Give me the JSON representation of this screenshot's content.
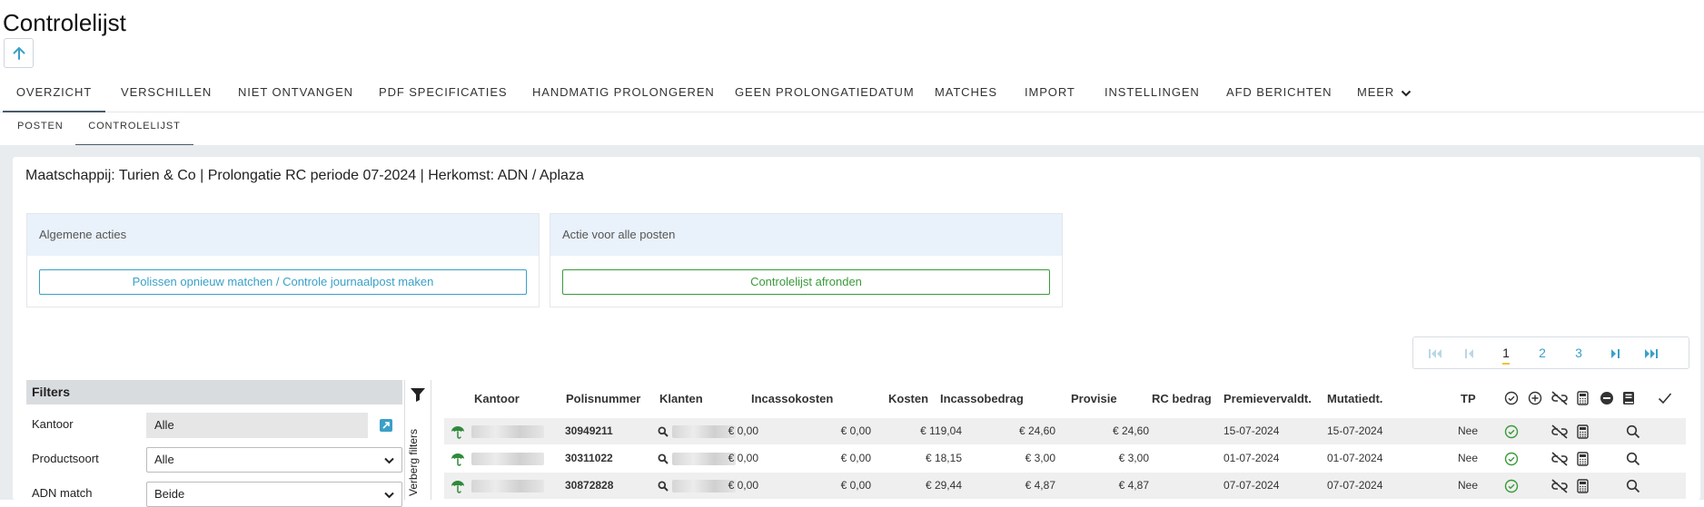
{
  "page": {
    "title": "Controlelijst"
  },
  "tabs": [
    {
      "label": "OVERZICHT",
      "active": true
    },
    {
      "label": "VERSCHILLEN"
    },
    {
      "label": "NIET ONTVANGEN"
    },
    {
      "label": "PDF SPECIFICATIES"
    },
    {
      "label": "HANDMATIG PROLONGEREN"
    },
    {
      "label": "GEEN PROLONGATIEDATUM"
    },
    {
      "label": "MATCHES"
    },
    {
      "label": "IMPORT"
    },
    {
      "label": "INSTELLINGEN"
    },
    {
      "label": "AFD BERICHTEN"
    },
    {
      "label": "MEER"
    }
  ],
  "subtabs": [
    {
      "label": "POSTEN"
    },
    {
      "label": "CONTROLELIJST",
      "active": true
    }
  ],
  "context": "Maatschappij: Turien & Co | Prolongatie RC periode 07-2024 | Herkomst: ADN / Aplaza",
  "cards": {
    "general": {
      "title": "Algemene acties",
      "button": "Polissen opnieuw matchen / Controle journaalpost maken",
      "color": "#3aa0c8"
    },
    "all": {
      "title": "Actie voor alle posten",
      "button": "Controlelijst afronden",
      "color": "#3a9a3a"
    }
  },
  "pagination": {
    "pages": [
      "1",
      "2",
      "3"
    ],
    "current": "1"
  },
  "filters": {
    "title": "Filters",
    "items": [
      {
        "label": "Kantoor",
        "value": "Alle"
      },
      {
        "label": "Productsoort",
        "value": "Alle"
      },
      {
        "label": "ADN match",
        "value": "Beide"
      }
    ],
    "toggle_label": "Verberg filters"
  },
  "table": {
    "headers": {
      "kantoor": "Kantoor",
      "polisnummer": "Polisnummer",
      "klanten": "Klanten",
      "incassokosten": "Incassokosten",
      "kosten": "Kosten",
      "incassobedrag": "Incassobedrag",
      "provisie": "Provisie",
      "rc_bedrag": "RC bedrag",
      "premievervaldt": "Premievervaldt.",
      "mutatiedt": "Mutatiedt.",
      "tp": "TP"
    },
    "rows": [
      {
        "polisnummer": "30949211",
        "incassokosten": "€ 0,00",
        "kosten": "€ 0,00",
        "incassobedrag": "€ 119,04",
        "provisie": "€ 24,60",
        "rc_bedrag": "€ 24,60",
        "premievervaldt": "15-07-2024",
        "mutatiedt": "15-07-2024",
        "tp": "Nee"
      },
      {
        "polisnummer": "30311022",
        "incassokosten": "€ 0,00",
        "kosten": "€ 0,00",
        "incassobedrag": "€ 18,15",
        "provisie": "€ 3,00",
        "rc_bedrag": "€ 3,00",
        "premievervaldt": "01-07-2024",
        "mutatiedt": "01-07-2024",
        "tp": "Nee"
      },
      {
        "polisnummer": "30872828",
        "incassokosten": "€ 0,00",
        "kosten": "€ 0,00",
        "incassobedrag": "€ 29,44",
        "provisie": "€ 4,87",
        "rc_bedrag": "€ 4,87",
        "premievervaldt": "07-07-2024",
        "mutatiedt": "07-07-2024",
        "tp": "Nee"
      }
    ]
  },
  "colors": {
    "link": "#3aa0c8",
    "success": "#3a9a3a",
    "umbrella": "#2f8a3a"
  }
}
